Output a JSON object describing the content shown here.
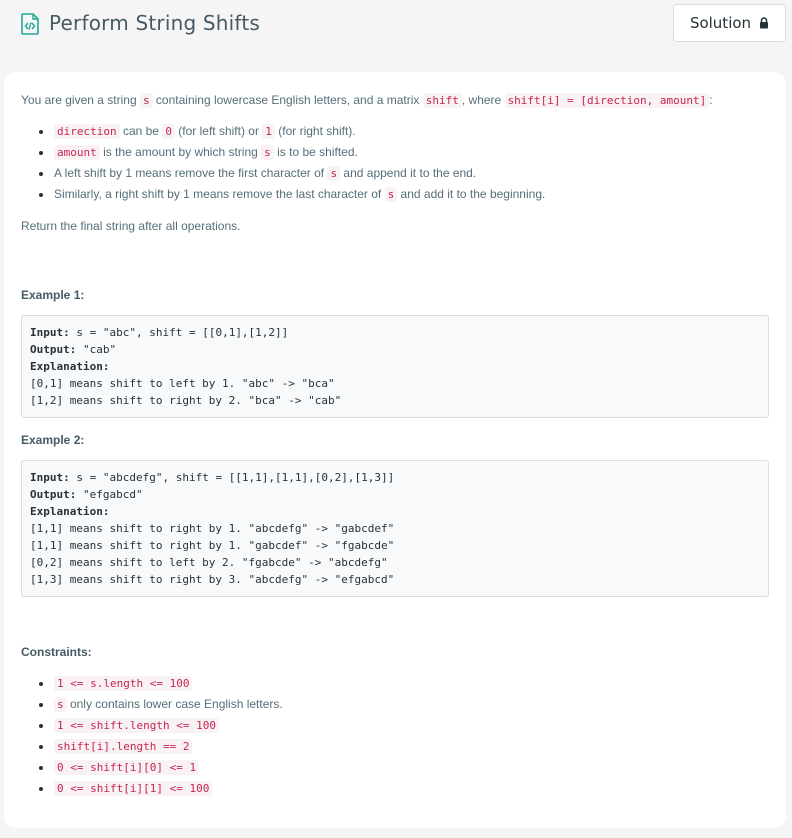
{
  "header": {
    "title": "Perform String Shifts",
    "solution_label": "Solution",
    "icon": "document-code-icon",
    "lock_icon": "lock-icon",
    "accent": "#26a69a"
  },
  "description": {
    "intro": {
      "t1": "You are given a string ",
      "c1": "s",
      "t2": " containing lowercase English letters, and a matrix ",
      "c2": "shift",
      "t3": ", where ",
      "c3": "shift[i] = [direction, amount]",
      "t4": ":"
    },
    "bullets": {
      "b1": {
        "c1": "direction",
        "t1": " can be ",
        "c2": "0",
        "t2": " (for left shift) or ",
        "c3": "1",
        "t3": " (for right shift)."
      },
      "b2": {
        "c1": "amount",
        "t1": " is the amount by which string ",
        "c2": "s",
        "t2": " is to be shifted."
      },
      "b3": {
        "t1": "A left shift by 1 means remove the first character of ",
        "c1": "s",
        "t2": " and append it to the end."
      },
      "b4": {
        "t1": "Similarly, a right shift by 1 means remove the last character of ",
        "c1": "s",
        "t2": " and add it to the beginning."
      }
    },
    "return_text": "Return the final string after all operations."
  },
  "examples": [
    {
      "heading": "Example 1:",
      "input_label": "Input:",
      "input": " s = \"abc\", shift = [[0,1],[1,2]]",
      "output_label": "Output:",
      "output": " \"cab\"",
      "explanation_label": "Explanation:",
      "lines": [
        "[0,1] means shift to left by 1. \"abc\" -> \"bca\"",
        "[1,2] means shift to right by 2. \"bca\" -> \"cab\""
      ]
    },
    {
      "heading": "Example 2:",
      "input_label": "Input:",
      "input": " s = \"abcdefg\", shift = [[1,1],[1,1],[0,2],[1,3]]",
      "output_label": "Output:",
      "output": " \"efgabcd\"",
      "explanation_label": "Explanation:",
      "lines": [
        "[1,1] means shift to right by 1. \"abcdefg\" -> \"gabcdef\"",
        "[1,1] means shift to right by 1. \"gabcdef\" -> \"fgabcde\"",
        "[0,2] means shift to left by 2. \"fgabcde\" -> \"abcdefg\"",
        "[1,3] means shift to right by 3. \"abcdefg\" -> \"efgabcd\""
      ]
    }
  ],
  "constraints": {
    "heading": "Constraints:",
    "items": {
      "c1": "1 <= s.length <= 100",
      "c2_code": "s",
      "c2_text": " only contains lower case English letters.",
      "c3": "1 <= shift.length <= 100",
      "c4": "shift[i].length == 2",
      "c5": "0 <= shift[i][0] <= 1",
      "c6": "0 <= shift[i][1] <= 100"
    }
  }
}
